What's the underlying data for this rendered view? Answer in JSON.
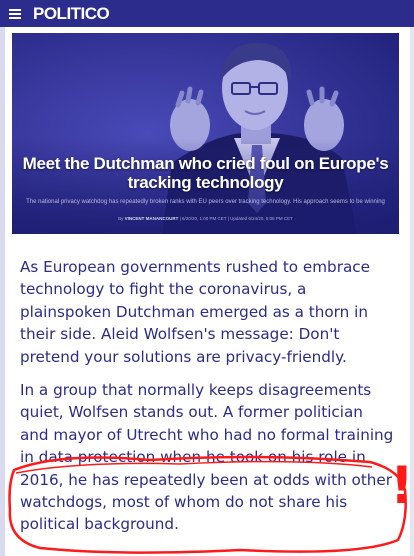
{
  "header": {
    "logo_text": "POLITICO",
    "background": "#2c2c8c"
  },
  "hero": {
    "headline": "Meet the Dutchman who cried foul on Europe's tracking technology",
    "standfirst": "The national privacy watchdog has repeatedly broken ranks with EU peers over tracking technology. His approach seems to be winning",
    "byline_prefix": "By",
    "byline_author": "VINCENT MANANCOURT",
    "byline_dates": "| 6/20/20, 1:00 PM CET | Updated 6/24/20, 5:08 PM CET"
  },
  "article": {
    "paragraph_1": "As European governments rushed to embrace technology to fight the coronavirus, a plainspoken Dutchman emerged as a thorn in their side. Aleid Wolfsen's message: Don't pretend your solutions are privacy-friendly.",
    "paragraph_2": "In a group that normally keeps disagreements quiet, Wolfsen stands out. A former politician and mayor of Utrecht who had no formal training in data protection when he took on his role in 2016, he has repeatedly been at odds with other watchdogs, most of whom do not share his political background."
  },
  "annotation": {
    "mark": "!",
    "color": "#ff1a1a"
  }
}
